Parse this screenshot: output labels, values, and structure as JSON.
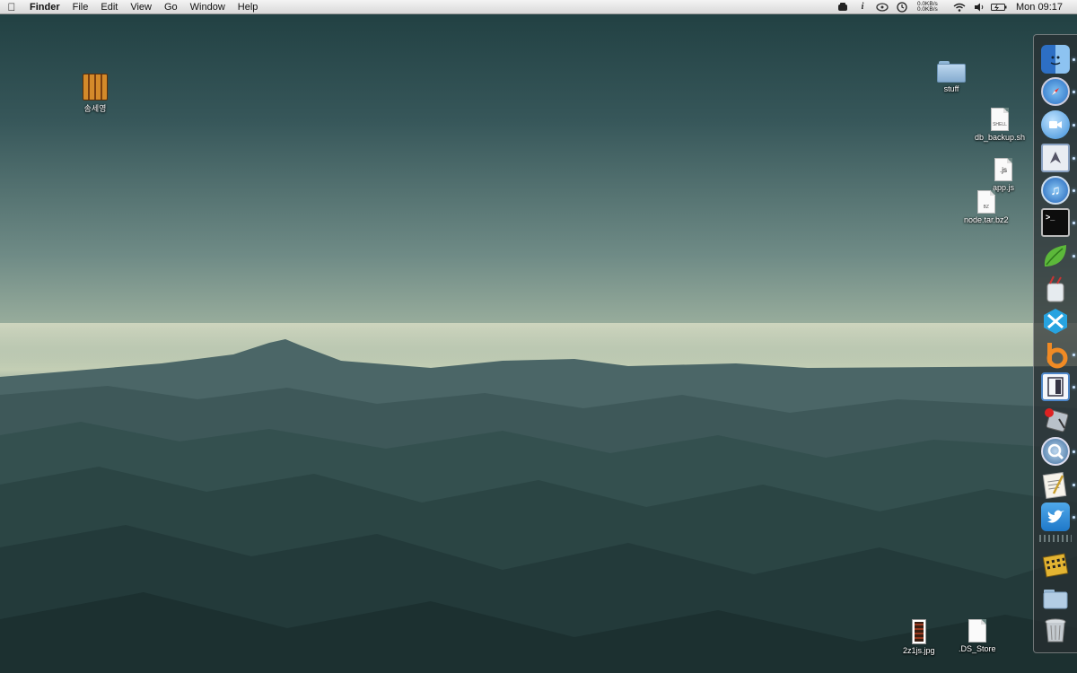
{
  "menubar": {
    "apple_icon": "apple-logo",
    "app_name": "Finder",
    "menus": [
      "File",
      "Edit",
      "View",
      "Go",
      "Window",
      "Help"
    ],
    "status_icons": [
      "dropbox-icon",
      "info-icon",
      "growl-icon",
      "time-machine-icon"
    ],
    "net_up": "0.0KB/s",
    "net_down": "0.0KB/s",
    "wifi_icon": "wifi-icon",
    "volume_icon": "volume-icon",
    "battery_icon": "battery-icon",
    "clock": "Mon 09:17"
  },
  "desktop": {
    "icons": [
      {
        "label": "송세영",
        "type": "archive"
      },
      {
        "label": "stuff",
        "type": "folder"
      },
      {
        "label": "db_backup.sh",
        "type": "shell-document",
        "tag": "SHELL"
      },
      {
        "label": "app.js",
        "type": "js-document",
        "tag": ".js"
      },
      {
        "label": "node.tar.bz2",
        "type": "bz2-archive",
        "tag": "BZ"
      },
      {
        "label": "2z1js.jpg",
        "type": "image"
      },
      {
        "label": ".DS_Store",
        "type": "document"
      }
    ]
  },
  "dock": {
    "apps": [
      {
        "name": "finder-icon",
        "running": true,
        "color": "#4a8fd8"
      },
      {
        "name": "safari-icon",
        "running": true,
        "color": "#3c8ee0"
      },
      {
        "name": "ichat-icon",
        "running": true,
        "color": "#5aa9ee"
      },
      {
        "name": "mail-icon",
        "running": true,
        "color": "#7a93b8"
      },
      {
        "name": "itunes-icon",
        "running": true,
        "color": "#2f7fd6"
      },
      {
        "name": "terminal-icon",
        "running": true,
        "color": "#111111"
      },
      {
        "name": "leaf-icon",
        "running": true,
        "color": "#56b136"
      },
      {
        "name": "utility-cup-icon",
        "running": false,
        "color": "#dfe5ea"
      },
      {
        "name": "blue-cube-icon",
        "running": false,
        "color": "#29a8e6"
      },
      {
        "name": "orange-b-icon",
        "running": true,
        "color": "#f08a24"
      },
      {
        "name": "window-app-icon",
        "running": true,
        "color": "#f2f6fb"
      },
      {
        "name": "red-pin-tool-icon",
        "running": false,
        "color": "#b4bcc4"
      },
      {
        "name": "quicktime-icon",
        "running": true,
        "color": "#6b8fb6"
      },
      {
        "name": "textedit-icon",
        "running": true,
        "color": "#f3f0e6"
      },
      {
        "name": "twitter-icon",
        "running": true,
        "color": "#2b8ad6"
      }
    ],
    "stack_items": [
      {
        "name": "archive-utility-icon",
        "color": "#e2b330"
      },
      {
        "name": "documents-folder-icon",
        "color": "#a9c4dd"
      },
      {
        "name": "trash-icon",
        "color": "#c7cdd2"
      }
    ]
  }
}
